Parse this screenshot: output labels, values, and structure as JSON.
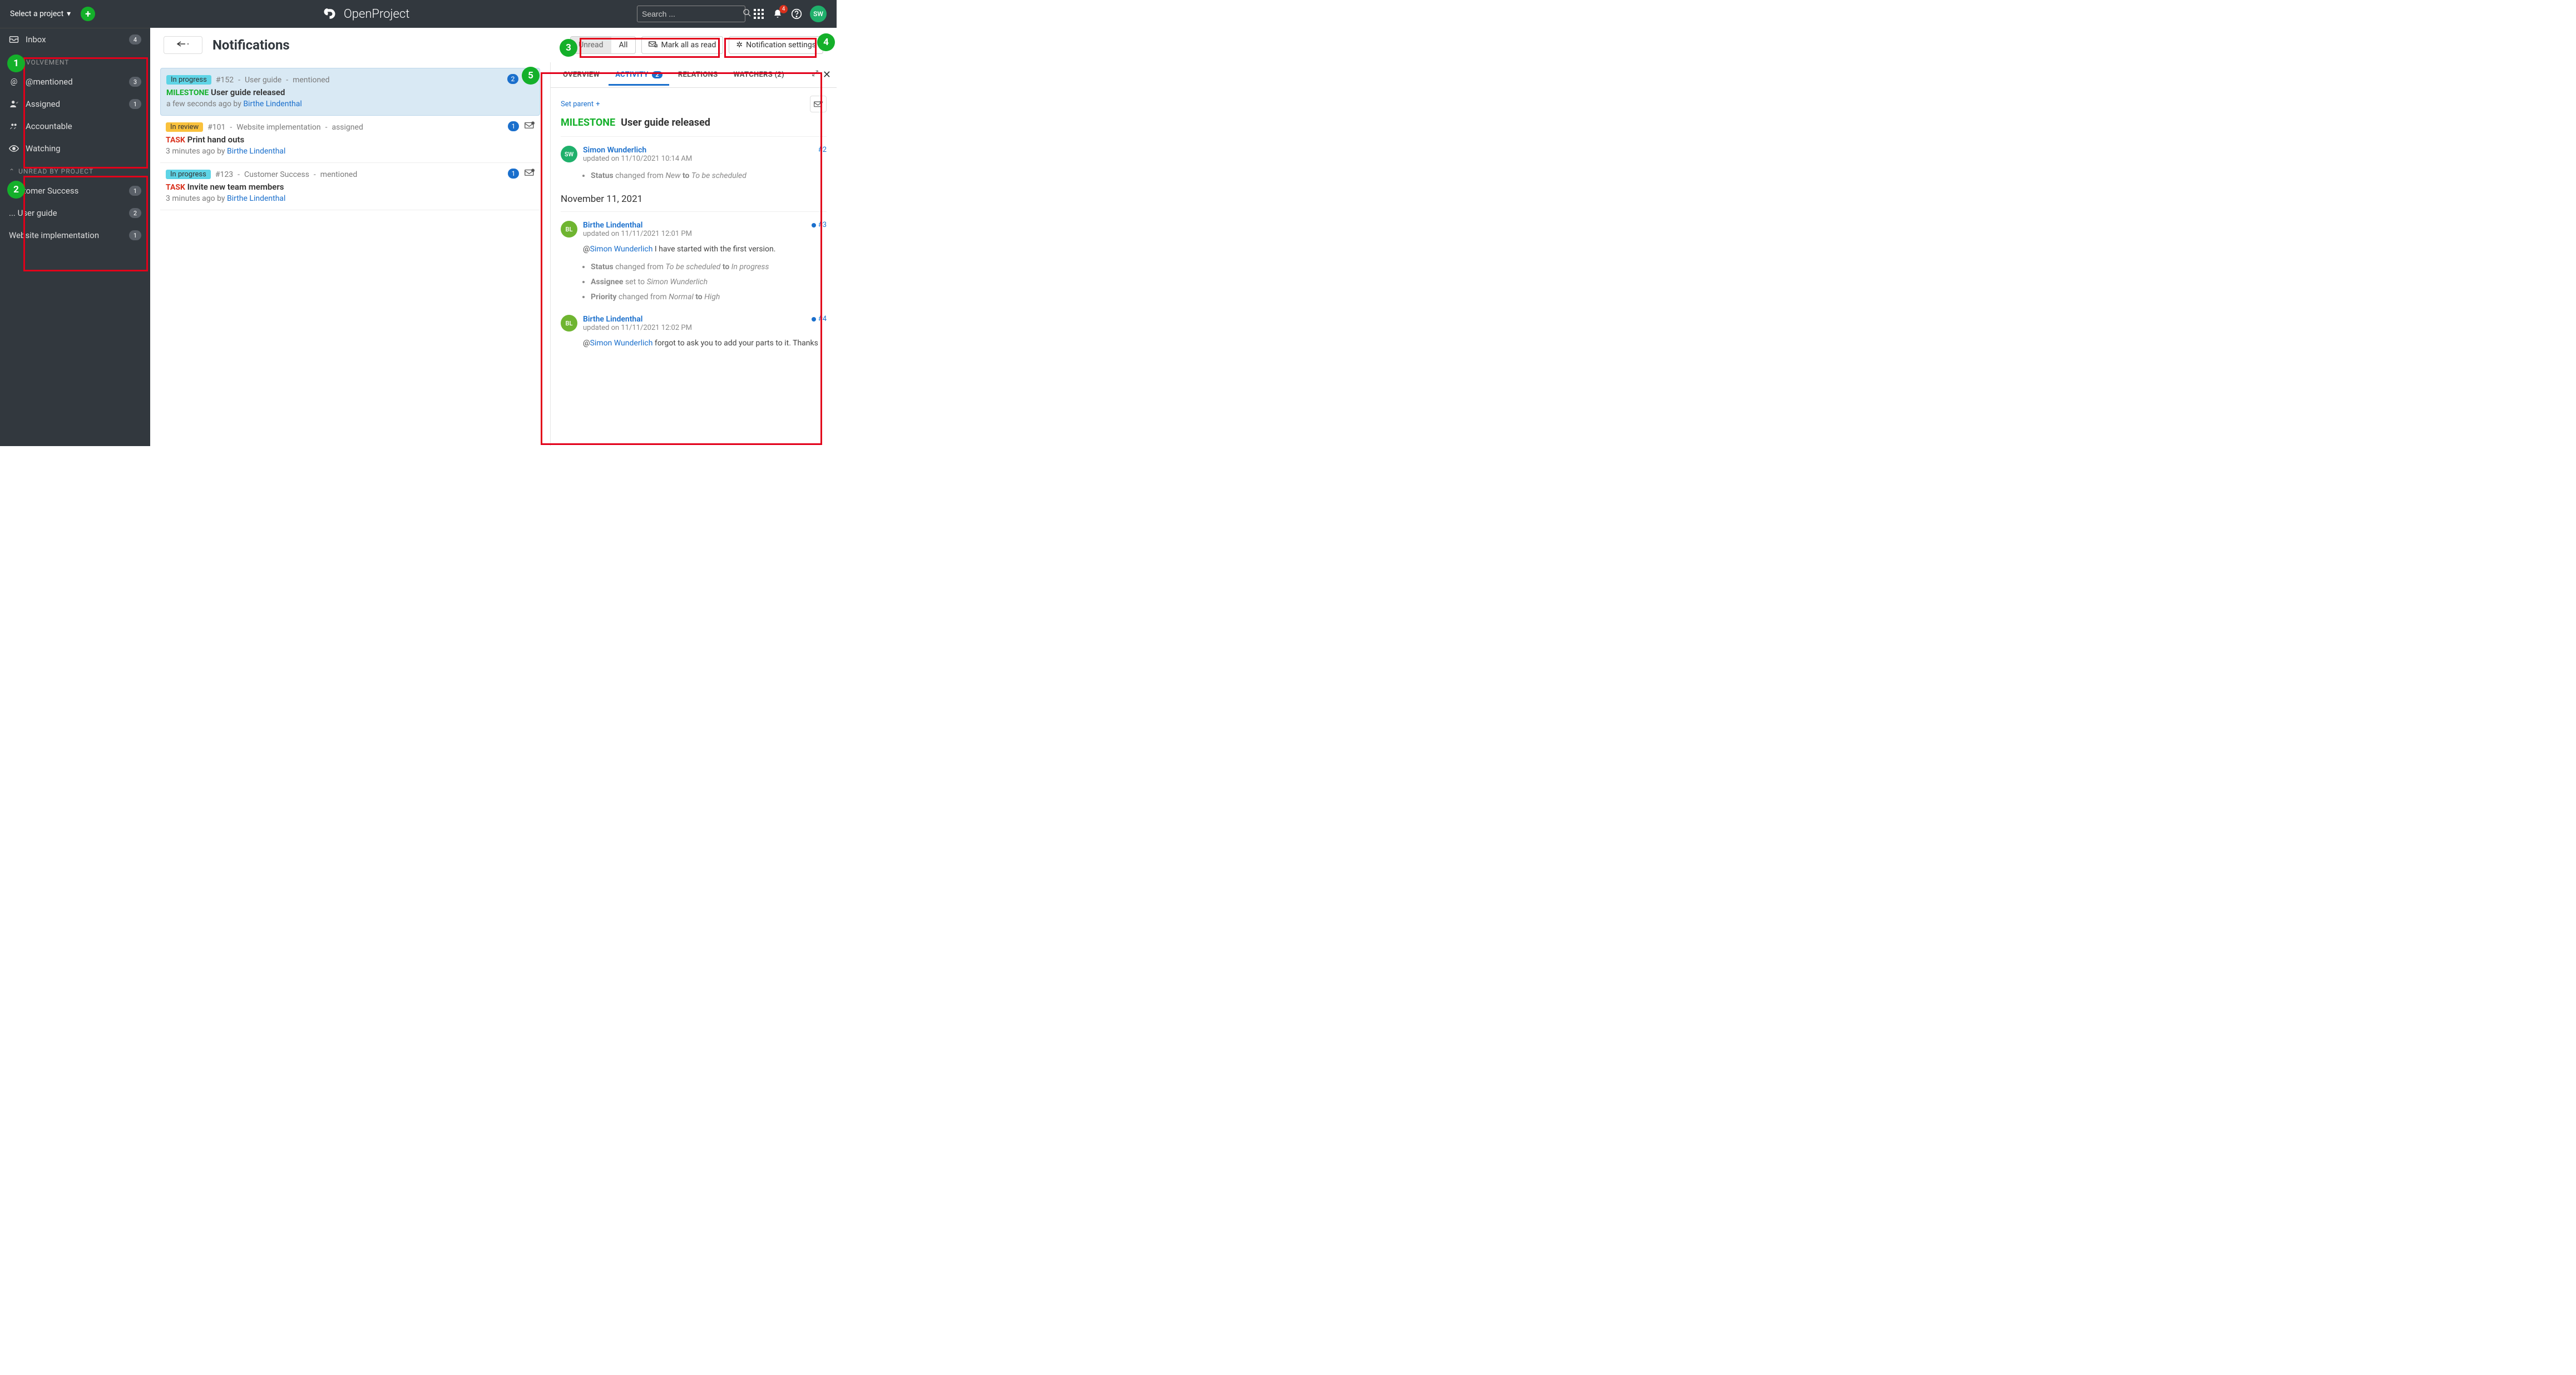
{
  "topbar": {
    "select_project": "Select a project",
    "brand": "OpenProject",
    "search_placeholder": "Search ...",
    "bell_count": "4",
    "avatar_initials": "SW"
  },
  "sidebar": {
    "inbox_label": "Inbox",
    "inbox_count": "4",
    "section_involvement": "INVOLVEMENT",
    "involvement": [
      {
        "label": "@mentioned",
        "count": "3",
        "icon": "at"
      },
      {
        "label": "Assigned",
        "count": "1",
        "icon": "user"
      },
      {
        "label": "Accountable",
        "count": "",
        "icon": "account"
      },
      {
        "label": "Watching",
        "count": "",
        "icon": "eye"
      }
    ],
    "section_unread": "UNREAD BY PROJECT",
    "projects": [
      {
        "label": "Customer Success",
        "count": "1"
      },
      {
        "label": "... User guide",
        "count": "2"
      },
      {
        "label": "Website implementation",
        "count": "1"
      }
    ]
  },
  "toolbar": {
    "back": "⟵",
    "title": "Notifications",
    "unread": "Unread",
    "all": "All",
    "mark_all": "Mark all as read",
    "settings": "Notification settings"
  },
  "notifications": [
    {
      "status": "In progress",
      "status_class": "chip-progress",
      "wp_id": "#152",
      "project": "User guide",
      "reason": "mentioned",
      "type": "MILESTONE",
      "type_class": "type-milestone",
      "title": "User guide released",
      "ago": "a few seconds ago by",
      "author": "Birthe Lindenthal",
      "count": "2",
      "selected": true
    },
    {
      "status": "In review",
      "status_class": "chip-review",
      "wp_id": "#101",
      "project": "Website implementation",
      "reason": "assigned",
      "type": "TASK",
      "type_class": "type-task",
      "title": "Print hand outs",
      "ago": "3 minutes ago by",
      "author": "Birthe Lindenthal",
      "count": "1",
      "selected": false
    },
    {
      "status": "In progress",
      "status_class": "chip-progress",
      "wp_id": "#123",
      "project": "Customer Success",
      "reason": "mentioned",
      "type": "TASK",
      "type_class": "type-task",
      "title": "Invite new team members",
      "ago": "3 minutes ago by",
      "author": "Birthe Lindenthal",
      "count": "1",
      "selected": false
    }
  ],
  "detail": {
    "tabs": {
      "overview": "OVERVIEW",
      "activity": "ACTIVITY",
      "activity_count": "2",
      "relations": "RELATIONS",
      "watchers": "WATCHERS (2)"
    },
    "set_parent": "Set parent",
    "type": "MILESTONE",
    "title": "User guide released",
    "activity": {
      "entry2": {
        "initials": "SW",
        "user": "Simon Wunderlich",
        "time": "updated on 11/10/2021 10:14 AM",
        "num": "#2",
        "change_field": "Status",
        "change_verb": "changed from",
        "change_from": "New",
        "change_to_label": "to",
        "change_to": "To be scheduled"
      },
      "date_divider": "November 11, 2021",
      "entry3": {
        "initials": "BL",
        "user": "Birthe Lindenthal",
        "time": "updated on 11/11/2021 12:01 PM",
        "num": "#3",
        "text_prefix": "@",
        "mention": "Simon Wunderlich",
        "text_rest": " I have started with the first version.",
        "c1_field": "Status",
        "c1_verb": "changed from",
        "c1_from": "To be scheduled",
        "c1_to_lbl": "to",
        "c1_to": "In progress",
        "c2_field": "Assignee",
        "c2_verb": "set to",
        "c2_to": "Simon Wunderlich",
        "c3_field": "Priority",
        "c3_verb": "changed from",
        "c3_from": "Normal",
        "c3_to_lbl": "to",
        "c3_to": "High"
      },
      "entry4": {
        "initials": "BL",
        "user": "Birthe Lindenthal",
        "time": "updated on 11/11/2021 12:02 PM",
        "num": "#4",
        "text_prefix": "@",
        "mention": "Simon Wunderlich",
        "text_rest": " forgot to ask you to add your parts to it. Thanks"
      }
    }
  },
  "callouts": {
    "c1": "1",
    "c2": "2",
    "c3": "3",
    "c4": "4",
    "c5": "5"
  }
}
